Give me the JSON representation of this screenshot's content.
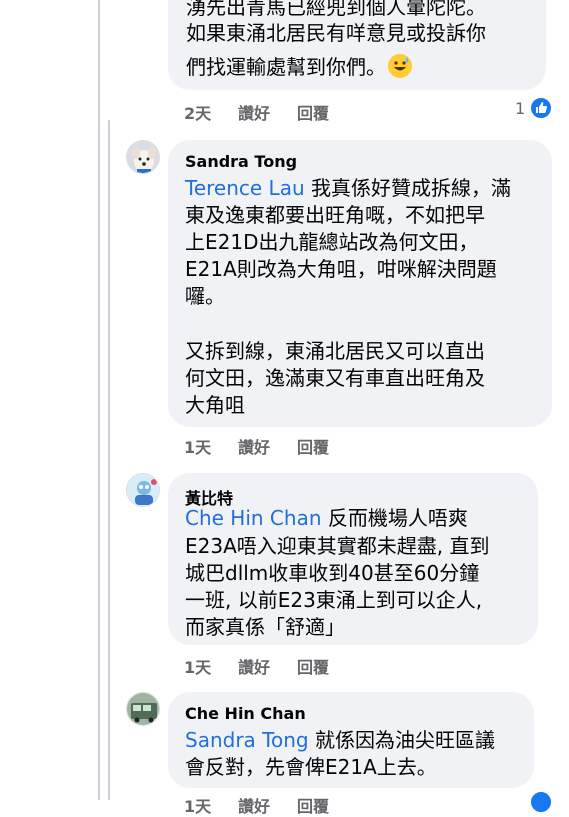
{
  "comments": [
    {
      "author": "",
      "lines": [
        "湧先出青馬已經兜到個人暈陀陀。",
        "如果東涌北居民有咩意見或投訴你",
        "們找運輸處幫到你們。"
      ],
      "emoji": "grinning-sweat-emoji",
      "time": "2天",
      "like": "讚好",
      "reply": "回覆",
      "reactions": "1"
    },
    {
      "author": "Sandra Tong",
      "mention": "Terence Lau",
      "lines": [
        " 我真係好贊成拆線，滿",
        "東及逸東都要出旺角嘅，不如把早",
        "上E21D出九龍總站改為何文田，",
        "E21A則改為大角咀，咁咪解決問題",
        "囉。",
        "",
        "又拆到線，東涌北居民又可以直出",
        "何文田，逸滿東又有車直出旺角及",
        "大角咀"
      ],
      "time": "1天",
      "like": "讚好",
      "reply": "回覆"
    },
    {
      "author": "黃比特",
      "mention": "Che Hin Chan",
      "lines": [
        " 反而機場人唔爽",
        "E23A唔入迎東其實都未趕盡, 直到",
        "城巴dllm收車收到40甚至60分鐘",
        "一班, 以前E23東涌上到可以企人,",
        "而家真係「舒適」"
      ],
      "time": "1天",
      "like": "讚好",
      "reply": "回覆"
    },
    {
      "author": "Che Hin Chan",
      "mention": "Sandra Tong",
      "lines": [
        " 就係因為油尖旺區議",
        "會反對，先會俾E21A上去。"
      ],
      "time": "1天",
      "like": "讚好",
      "reply": "回覆"
    }
  ],
  "colors": {
    "mention": "#216fdb",
    "bubble": "#f0f2f5",
    "meta": "#65676b",
    "like": "#1877f2"
  }
}
